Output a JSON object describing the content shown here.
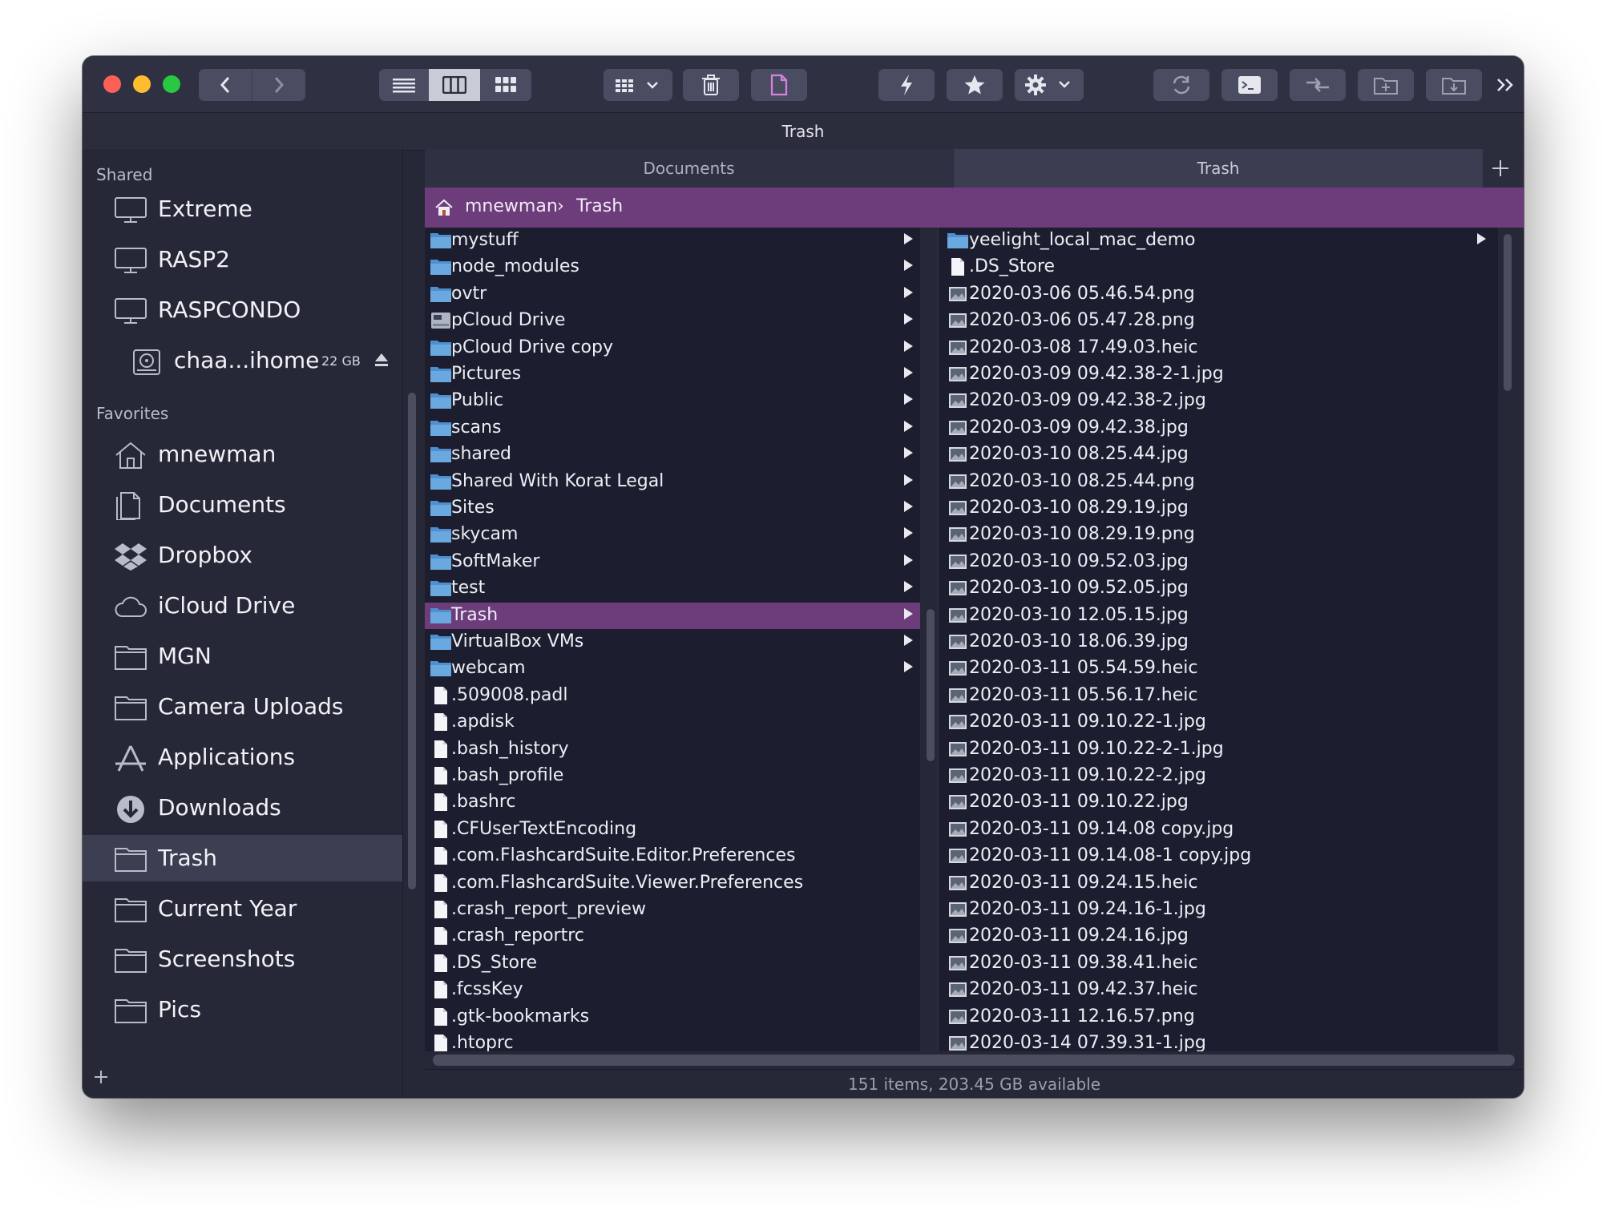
{
  "window": {
    "title": "Trash",
    "status_text": "151 items, 203.45 GB available"
  },
  "colors": {
    "window_bg": "#262838",
    "column_bg": "#1c1e2f",
    "accent_purple": "#6c3c7b",
    "folder_blue": "#6aa8e0",
    "traffic_close": "#fe5f57",
    "traffic_min": "#febc2e",
    "traffic_max": "#28c840"
  },
  "toolbar": {
    "buttons": [
      "back-icon",
      "forward-icon",
      "list-view-icon",
      "column-view-icon",
      "icon-view-icon",
      "grid-menu-icon",
      "trash-icon",
      "new-file-icon",
      "lightning-icon",
      "star-icon",
      "gear-icon",
      "refresh-icon",
      "terminal-icon",
      "compare-icon",
      "new-folder-icon",
      "archive-icon",
      "overflow-icon"
    ]
  },
  "sidebar": {
    "shared_header": "Shared",
    "shared": [
      {
        "label": "Extreme",
        "icon": "computer-icon"
      },
      {
        "label": "RASP2",
        "icon": "computer-icon"
      },
      {
        "label": "RASPCONDO",
        "icon": "computer-icon"
      },
      {
        "label": "chaa...ihome",
        "icon": "disk-icon",
        "badge": "22 GB"
      }
    ],
    "favorites_header": "Favorites",
    "favorites": [
      {
        "label": "mnewman",
        "icon": "home-icon"
      },
      {
        "label": "Documents",
        "icon": "documents-icon"
      },
      {
        "label": "Dropbox",
        "icon": "dropbox-icon"
      },
      {
        "label": "iCloud Drive",
        "icon": "cloud-icon"
      },
      {
        "label": "MGN",
        "icon": "folder-icon"
      },
      {
        "label": "Camera Uploads",
        "icon": "folder-icon"
      },
      {
        "label": "Applications",
        "icon": "applications-icon"
      },
      {
        "label": "Downloads",
        "icon": "downloads-icon"
      },
      {
        "label": "Trash",
        "icon": "folder-icon",
        "selected": true
      },
      {
        "label": "Current Year",
        "icon": "folder-icon"
      },
      {
        "label": "Screenshots",
        "icon": "folder-icon"
      },
      {
        "label": "Pics",
        "icon": "folder-icon"
      }
    ]
  },
  "tabs": [
    {
      "label": "Documents",
      "active": false
    },
    {
      "label": "Trash",
      "active": true
    }
  ],
  "path": {
    "home": "mnewman",
    "separator": "›",
    "current": "Trash"
  },
  "column1": [
    {
      "name": "mystuff",
      "type": "folder"
    },
    {
      "name": "node_modules",
      "type": "folder"
    },
    {
      "name": "ovtr",
      "type": "folder"
    },
    {
      "name": "pCloud Drive",
      "type": "drive"
    },
    {
      "name": "pCloud Drive copy",
      "type": "folder"
    },
    {
      "name": "Pictures",
      "type": "folder"
    },
    {
      "name": "Public",
      "type": "folder"
    },
    {
      "name": "scans",
      "type": "folder"
    },
    {
      "name": "shared",
      "type": "folder"
    },
    {
      "name": "Shared With Korat Legal",
      "type": "folder"
    },
    {
      "name": "Sites",
      "type": "folder"
    },
    {
      "name": "skycam",
      "type": "folder"
    },
    {
      "name": "SoftMaker",
      "type": "folder"
    },
    {
      "name": "test",
      "type": "folder"
    },
    {
      "name": "Trash",
      "type": "folder",
      "selected": true
    },
    {
      "name": "VirtualBox VMs",
      "type": "folder"
    },
    {
      "name": "webcam",
      "type": "folder"
    },
    {
      "name": ".509008.padl",
      "type": "file"
    },
    {
      "name": ".apdisk",
      "type": "file"
    },
    {
      "name": ".bash_history",
      "type": "file"
    },
    {
      "name": ".bash_profile",
      "type": "file"
    },
    {
      "name": ".bashrc",
      "type": "file"
    },
    {
      "name": ".CFUserTextEncoding",
      "type": "file"
    },
    {
      "name": ".com.FlashcardSuite.Editor.Preferences",
      "type": "file"
    },
    {
      "name": ".com.FlashcardSuite.Viewer.Preferences",
      "type": "file"
    },
    {
      "name": ".crash_report_preview",
      "type": "file"
    },
    {
      "name": ".crash_reportrc",
      "type": "file"
    },
    {
      "name": ".DS_Store",
      "type": "file"
    },
    {
      "name": ".fcssKey",
      "type": "file"
    },
    {
      "name": ".gtk-bookmarks",
      "type": "file"
    },
    {
      "name": ".htoprc",
      "type": "file"
    }
  ],
  "column2": [
    {
      "name": "yeelight_local_mac_demo",
      "type": "folder"
    },
    {
      "name": ".DS_Store",
      "type": "file"
    },
    {
      "name": "2020-03-06 05.46.54.png",
      "type": "image"
    },
    {
      "name": "2020-03-06 05.47.28.png",
      "type": "image"
    },
    {
      "name": "2020-03-08 17.49.03.heic",
      "type": "image"
    },
    {
      "name": "2020-03-09 09.42.38-2-1.jpg",
      "type": "image"
    },
    {
      "name": "2020-03-09 09.42.38-2.jpg",
      "type": "image"
    },
    {
      "name": "2020-03-09 09.42.38.jpg",
      "type": "image"
    },
    {
      "name": "2020-03-10 08.25.44.jpg",
      "type": "image"
    },
    {
      "name": "2020-03-10 08.25.44.png",
      "type": "image"
    },
    {
      "name": "2020-03-10 08.29.19.jpg",
      "type": "image"
    },
    {
      "name": "2020-03-10 08.29.19.png",
      "type": "image"
    },
    {
      "name": "2020-03-10 09.52.03.jpg",
      "type": "image"
    },
    {
      "name": "2020-03-10 09.52.05.jpg",
      "type": "image"
    },
    {
      "name": "2020-03-10 12.05.15.jpg",
      "type": "image"
    },
    {
      "name": "2020-03-10 18.06.39.jpg",
      "type": "image"
    },
    {
      "name": "2020-03-11 05.54.59.heic",
      "type": "image"
    },
    {
      "name": "2020-03-11 05.56.17.heic",
      "type": "image"
    },
    {
      "name": "2020-03-11 09.10.22-1.jpg",
      "type": "image"
    },
    {
      "name": "2020-03-11 09.10.22-2-1.jpg",
      "type": "image"
    },
    {
      "name": "2020-03-11 09.10.22-2.jpg",
      "type": "image"
    },
    {
      "name": "2020-03-11 09.10.22.jpg",
      "type": "image"
    },
    {
      "name": "2020-03-11 09.14.08 copy.jpg",
      "type": "image"
    },
    {
      "name": "2020-03-11 09.14.08-1 copy.jpg",
      "type": "image"
    },
    {
      "name": "2020-03-11 09.24.15.heic",
      "type": "image"
    },
    {
      "name": "2020-03-11 09.24.16-1.jpg",
      "type": "image"
    },
    {
      "name": "2020-03-11 09.24.16.jpg",
      "type": "image"
    },
    {
      "name": "2020-03-11 09.38.41.heic",
      "type": "image"
    },
    {
      "name": "2020-03-11 09.42.37.heic",
      "type": "image"
    },
    {
      "name": "2020-03-11 12.16.57.png",
      "type": "image"
    },
    {
      "name": "2020-03-14 07.39.31-1.jpg",
      "type": "image"
    }
  ]
}
